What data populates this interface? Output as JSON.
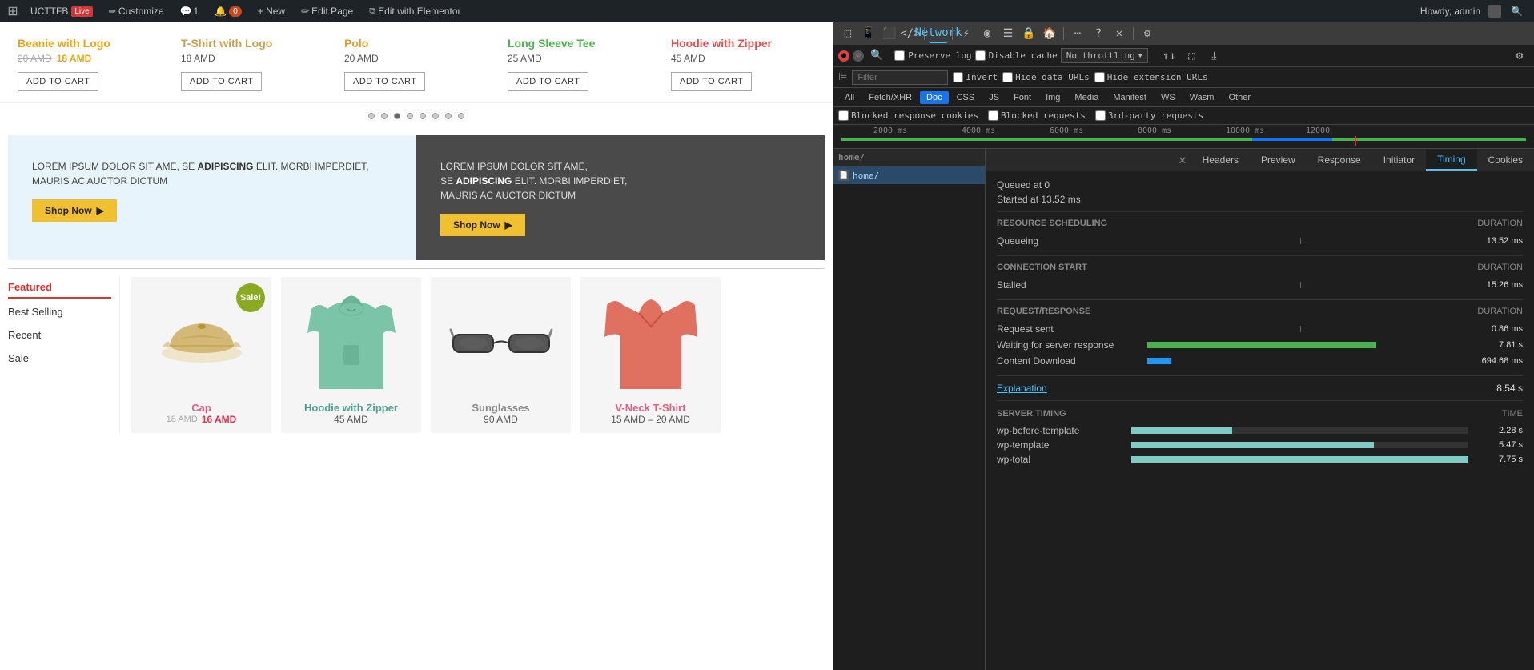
{
  "adminBar": {
    "site_name": "UCTTFB",
    "live_label": "Live",
    "customize_label": "Customize",
    "comment_count": "1",
    "comment_notif": "0",
    "new_label": "+ New",
    "edit_page_label": "Edit Page",
    "edit_elementor_label": "Edit with Elementor",
    "howdy_label": "Howdy, admin",
    "search_icon": "🔍"
  },
  "products": [
    {
      "name": "Beanie with Logo",
      "price_old": "20 AMD",
      "price_new": "18 AMD",
      "has_sale": true,
      "btn": "ADD TO CART"
    },
    {
      "name": "T-Shirt with Logo",
      "price_plain": "18 AMD",
      "btn": "ADD TO CART"
    },
    {
      "name": "Polo",
      "price_plain": "20 AMD",
      "btn": "ADD TO CART"
    },
    {
      "name": "Long Sleeve Tee",
      "price_plain": "25 AMD",
      "btn": "ADD TO CART"
    },
    {
      "name": "Hoodie with Zipper",
      "price_plain": "45 AMD",
      "btn": "ADD TO CART"
    }
  ],
  "promo": {
    "light": {
      "text": "LOREM IPSUM DOLOR SIT AME, SE ADIPISCING ELIT. MORBI IMPERDIET, MAURIS AC AUCTOR DICTUM",
      "btn": "Shop Now"
    },
    "dark": {
      "text": "LOREM IPSUM DOLOR SIT AME, SE ADIPISCING ELIT. MORBI IMPERDIET, MAURIS AC AUCTOR DICTUM",
      "btn": "Shop Now"
    }
  },
  "featured": {
    "section_label": "Featured",
    "tabs": [
      "Featured",
      "Best Selling",
      "Recent",
      "Sale"
    ],
    "products": [
      {
        "name": "Cap",
        "price_old": "18 AMD",
        "price_new": "16 AMD",
        "has_sale": true
      },
      {
        "name": "Hoodie with Zipper",
        "price_plain": "45 AMD"
      },
      {
        "name": "Sunglasses",
        "price_plain": "90 AMD"
      },
      {
        "name": "V-Neck T-Shirt",
        "price_range": "15 AMD – 20 AMD"
      }
    ]
  },
  "devtools": {
    "active_tab": "Network",
    "tabs": [
      "Elements",
      "Console",
      "Sources",
      "Network",
      "Performance",
      "Memory",
      "Application",
      "Security",
      "Lighthouse"
    ],
    "toolbar_icons": [
      "record",
      "clear",
      "search",
      "settings"
    ],
    "preserve_log": "Preserve log",
    "disable_cache": "Disable cache",
    "no_throttling": "No throttling",
    "filter_placeholder": "Filter",
    "invert_label": "Invert",
    "hide_data_urls": "Hide data URLs",
    "hide_ext_urls": "Hide extension URLs",
    "type_filters": [
      "All",
      "Fetch/XHR",
      "Doc",
      "CSS",
      "JS",
      "Font",
      "Img",
      "Media",
      "Manifest",
      "WS",
      "Wasm",
      "Other"
    ],
    "active_type": "Doc",
    "blocked_cookies": "Blocked response cookies",
    "blocked_requests": "Blocked requests",
    "third_party": "3rd-party requests",
    "timeline": {
      "labels": [
        "2000 ms",
        "4000 ms",
        "6000 ms",
        "8000 ms",
        "10000 ms",
        "12000"
      ]
    },
    "request": {
      "name": "home/",
      "icon": "📄"
    },
    "detail_tabs": [
      "Headers",
      "Preview",
      "Response",
      "Initiator",
      "Timing",
      "Cookies"
    ],
    "active_detail_tab": "Timing",
    "timing": {
      "queued_at": "Queued at 0",
      "started_at": "Started at 13.52 ms",
      "resource_scheduling_header": "Resource Scheduling",
      "duration_header": "DURATION",
      "queueing_label": "Queueing",
      "queueing_val": "13.52 ms",
      "connection_start_header": "Connection Start",
      "stalled_label": "Stalled",
      "stalled_val": "15.26 ms",
      "request_response_header": "Request/Response",
      "request_sent_label": "Request sent",
      "request_sent_val": "0.86 ms",
      "waiting_label": "Waiting for server response",
      "waiting_val": "7.81 s",
      "content_download_label": "Content Download",
      "content_download_val": "694.68 ms",
      "explanation_label": "Explanation",
      "explanation_val": "8.54 s",
      "server_timing_header": "Server Timing",
      "time_header": "TIME",
      "server_rows": [
        {
          "name": "wp-before-template",
          "val": "2.28 s",
          "pct": 30
        },
        {
          "name": "wp-template",
          "val": "5.47 s",
          "pct": 72
        },
        {
          "name": "wp-total",
          "val": "7.75 s",
          "pct": 100
        }
      ]
    }
  }
}
